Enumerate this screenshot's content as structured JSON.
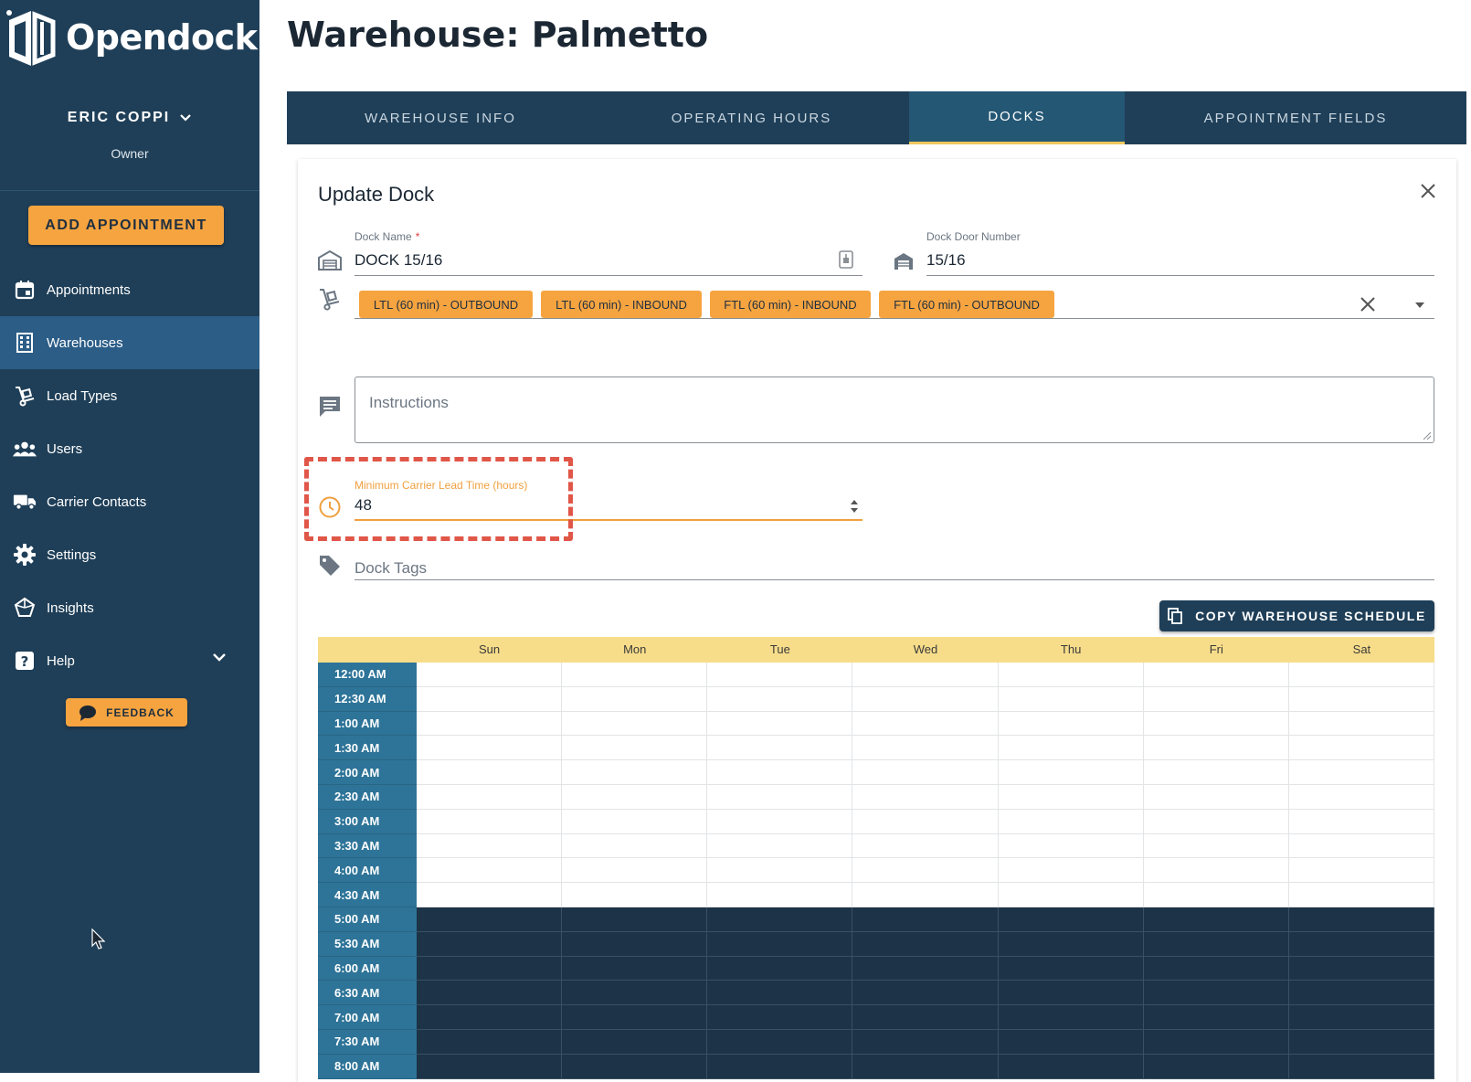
{
  "app": {
    "name": "Opendock"
  },
  "user": {
    "name": "ERIC COPPI",
    "role": "Owner"
  },
  "sidebar": {
    "add_button": "ADD APPOINTMENT",
    "items": [
      {
        "label": "Appointments",
        "icon": "calendar-icon"
      },
      {
        "label": "Warehouses",
        "icon": "building-icon",
        "active": true
      },
      {
        "label": "Load Types",
        "icon": "hand-truck-icon"
      },
      {
        "label": "Users",
        "icon": "users-icon"
      },
      {
        "label": "Carrier Contacts",
        "icon": "truck-icon"
      },
      {
        "label": "Settings",
        "icon": "gear-icon"
      },
      {
        "label": "Insights",
        "icon": "insights-icon"
      },
      {
        "label": "Help",
        "icon": "help-icon"
      }
    ],
    "feedback": "FEEDBACK"
  },
  "page": {
    "title": "Warehouse: Palmetto"
  },
  "tabs": [
    {
      "label": "WAREHOUSE INFO"
    },
    {
      "label": "OPERATING HOURS"
    },
    {
      "label": "DOCKS",
      "active": true
    },
    {
      "label": "APPOINTMENT FIELDS"
    }
  ],
  "dock_form": {
    "title": "Update Dock",
    "dock_name": {
      "label": "Dock Name",
      "required_mark": "*",
      "value": "DOCK 15/16"
    },
    "dock_door": {
      "label": "Dock Door Number",
      "value": "15/16"
    },
    "load_types": [
      "LTL (60 min) - OUTBOUND",
      "LTL (60 min) - INBOUND",
      "FTL (60 min) - INBOUND",
      "FTL (60 min) - OUTBOUND"
    ],
    "instructions": {
      "placeholder": "Instructions"
    },
    "lead_time": {
      "label": "Minimum Carrier Lead Time (hours)",
      "value": "48"
    },
    "dock_tags": {
      "placeholder": "Dock Tags"
    },
    "copy_button": "COPY WAREHOUSE SCHEDULE"
  },
  "schedule": {
    "days": [
      "Sun",
      "Mon",
      "Tue",
      "Wed",
      "Thu",
      "Fri",
      "Sat"
    ],
    "times": [
      "12:00 AM",
      "12:30 AM",
      "1:00 AM",
      "1:30 AM",
      "2:00 AM",
      "2:30 AM",
      "3:00 AM",
      "3:30 AM",
      "4:00 AM",
      "4:30 AM",
      "5:00 AM",
      "5:30 AM",
      "6:00 AM",
      "6:30 AM",
      "7:00 AM",
      "7:30 AM",
      "8:00 AM"
    ],
    "closed_from_time": "5:00 AM",
    "colors": {
      "open_slot": "#ffffff",
      "closed_slot": "#1d3347",
      "time_column": "#2e7498",
      "header": "#f7dd8a"
    }
  }
}
